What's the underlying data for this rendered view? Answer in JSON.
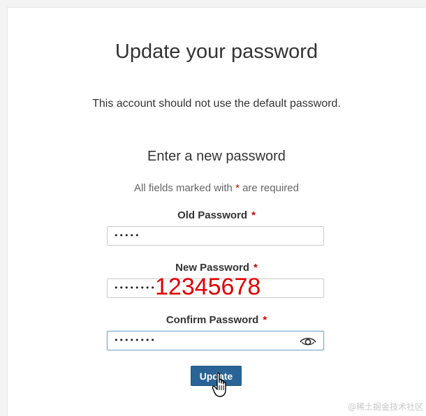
{
  "page": {
    "title": "Update your password",
    "notice": "This account should not use the default password.",
    "subtitle": "Enter a new password",
    "required_note": {
      "before": "All fields marked with",
      "star": "*",
      "after": "are required"
    }
  },
  "form": {
    "old_password": {
      "label": "Old Password",
      "star": "*",
      "masked_value": "•••••"
    },
    "new_password": {
      "label": "New Password",
      "star": "*",
      "masked_value": "••••••••"
    },
    "confirm_password": {
      "label": "Confirm Password",
      "star": "*",
      "masked_value": "••••••••"
    },
    "update_button": "Update"
  },
  "annotation": {
    "text": "12345678",
    "color": "#e00000"
  },
  "icons": {
    "reveal": "eye-icon",
    "cursor": "hand-pointer-icon"
  },
  "colors": {
    "button": "#2a6496",
    "required_star": "#cc0000"
  },
  "watermark": "@稀土掘金技术社区"
}
